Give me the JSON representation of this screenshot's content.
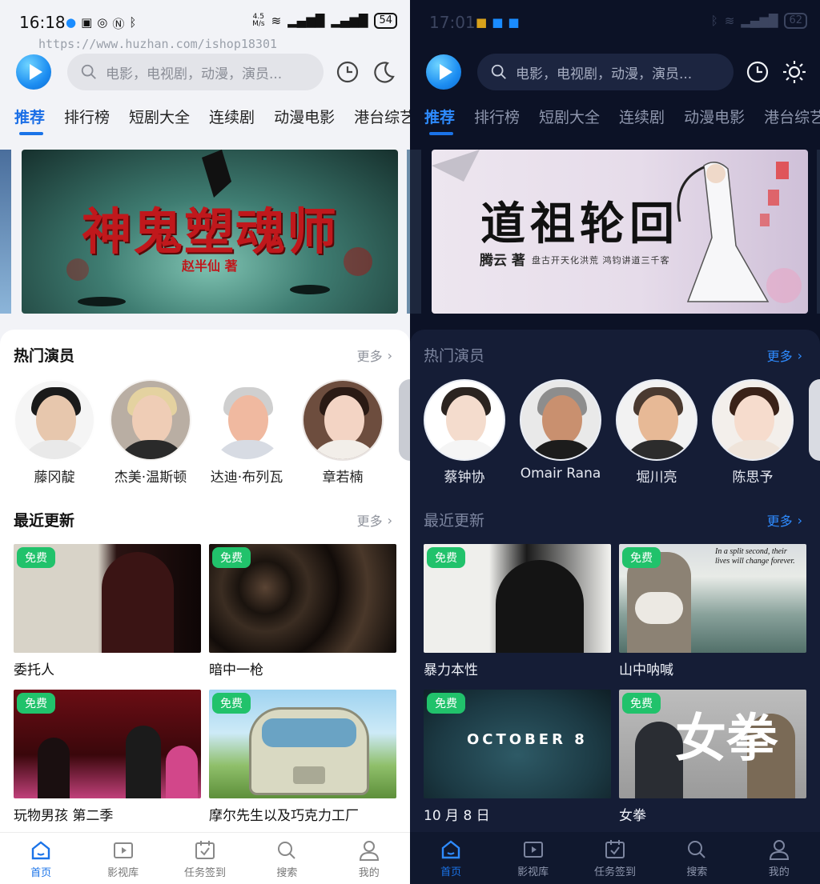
{
  "watermark": "https://www.huzhan.com/ishop18301",
  "panels": [
    {
      "theme": "light",
      "status": {
        "time": "16:18",
        "speed_top": "4.5",
        "speed_bottom": "M/s",
        "battery": "54"
      },
      "search_placeholder": "电影，电视剧，动漫，演员...",
      "tabs": [
        "推荐",
        "排行榜",
        "短剧大全",
        "连续剧",
        "动漫电影",
        "港台综艺"
      ],
      "banner": {
        "title": "神鬼塑魂师",
        "author": "赵半仙 著"
      },
      "actors_section": {
        "title": "热门演员",
        "more": "更多"
      },
      "actors": [
        "藤冈靛",
        "杰美·温斯顿",
        "达迪·布列瓦",
        "章若楠"
      ],
      "updates_section": {
        "title": "最近更新",
        "more": "更多"
      },
      "items": [
        {
          "title": "委托人",
          "badge": "免费"
        },
        {
          "title": "暗中一枪",
          "badge": "免费"
        },
        {
          "title": "玩物男孩 第二季",
          "badge": "免费"
        },
        {
          "title": "摩尔先生以及巧克力工厂",
          "badge": "免费"
        }
      ],
      "nav": [
        "首页",
        "影视库",
        "任务签到",
        "搜索",
        "我的"
      ]
    },
    {
      "theme": "dark",
      "status": {
        "time": "17:01",
        "battery": "62"
      },
      "search_placeholder": "电影，电视剧，动漫，演员...",
      "tabs": [
        "推荐",
        "排行榜",
        "短剧大全",
        "连续剧",
        "动漫电影",
        "港台综艺"
      ],
      "banner": {
        "title": "道祖轮回",
        "author": "腾云 著",
        "sub": "盘古开天化洪荒 鸿钧讲道三千客"
      },
      "actors_section": {
        "title": "热门演员",
        "more": "更多"
      },
      "actors": [
        "蔡钟协",
        "Omair Rana",
        "堀川亮",
        "陈思予"
      ],
      "updates_section": {
        "title": "最近更新",
        "more": "更多"
      },
      "items": [
        {
          "title": "暴力本性",
          "badge": "免费"
        },
        {
          "title": "山中呐喊",
          "badge": "免费",
          "poster_text": "In a split second, their lives will change forever."
        },
        {
          "title": "10 月 8 日",
          "badge": "免费",
          "poster_text": "OCTOBER 8"
        },
        {
          "title": "女拳",
          "badge": "免费",
          "poster_text": "女拳"
        }
      ],
      "nav": [
        "首页",
        "影视库",
        "任务签到",
        "搜索",
        "我的"
      ]
    }
  ],
  "colors": {
    "accent": "#1a73e8",
    "badge": "#21c26b",
    "dark_bg": "#0c1226",
    "light_bg": "#f2f3f7"
  }
}
